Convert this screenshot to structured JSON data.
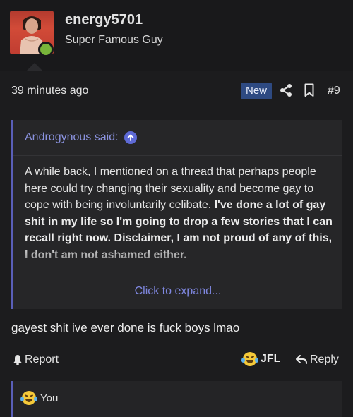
{
  "user": {
    "username": "energy5701",
    "title": "Super Famous Guy",
    "online_color": "#78b43a"
  },
  "post_meta": {
    "timestamp": "39 minutes ago",
    "new_badge": "New",
    "share_icon": "share-icon",
    "bookmark_icon": "bookmark-icon",
    "post_number": "#9"
  },
  "quote": {
    "author": "Androgynous said:",
    "icon": "arrow-up-circle-icon",
    "body_plain": "A while back, I mentioned on a thread that perhaps people here could try changing their sexuality and become gay to cope with being involuntarily celibate.",
    "body_bold": "I've done a lot of gay shit in my life so I'm going to drop a few stories that I can recall right now. Disclaimer, I am not proud of any of this, I don't am not ashamed either.",
    "expand_label": "Click to expand..."
  },
  "reply_text": "gayest shit ive ever done is fuck boys lmao",
  "actions": {
    "report_label": "Report",
    "reaction_label": "JFL",
    "reply_label": "Reply"
  },
  "reactions_bar": {
    "label": "You"
  },
  "colors": {
    "background": "#1c1c1e",
    "accent": "#5a5fb8",
    "link": "#7f87e0",
    "badge": "#2e4a82"
  }
}
